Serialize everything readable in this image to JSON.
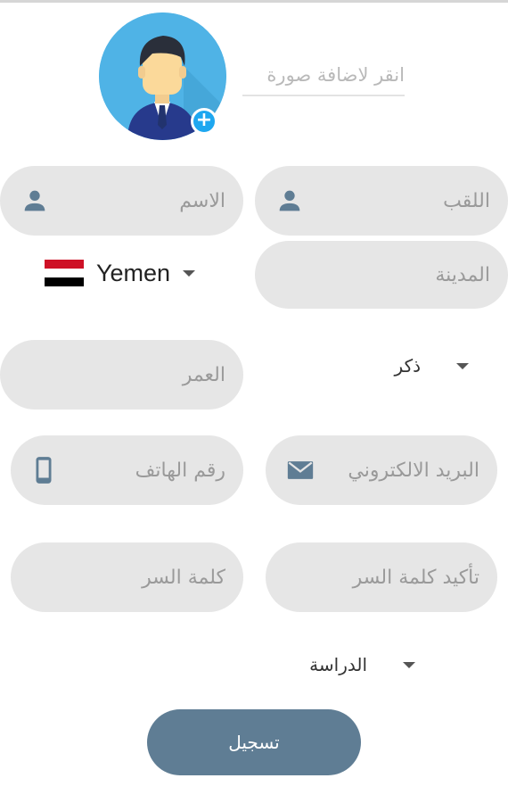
{
  "photo": {
    "hint": "انقر لاضافة صورة"
  },
  "fields": {
    "last_name": "اللقب",
    "first_name": "الاسم",
    "city": "المدينة",
    "age": "العمر",
    "email": "البريد الالكتروني",
    "phone": "رقم الهاتف",
    "confirm_password": "تأكيد كلمة السر",
    "password": "كلمة السر"
  },
  "country": {
    "name": "Yemen",
    "flag_colors": [
      "#ce1126",
      "#ffffff",
      "#000000"
    ]
  },
  "gender": {
    "selected": "ذكر"
  },
  "study": {
    "selected": "الدراسة"
  },
  "register_label": "تسجيل",
  "colors": {
    "field_bg": "#e6e6e6",
    "icon_color": "#5f7d94",
    "button_bg": "#5f7d94",
    "avatar_bg": "#4fb3e6",
    "plus_badge": "#1ea7f0"
  }
}
